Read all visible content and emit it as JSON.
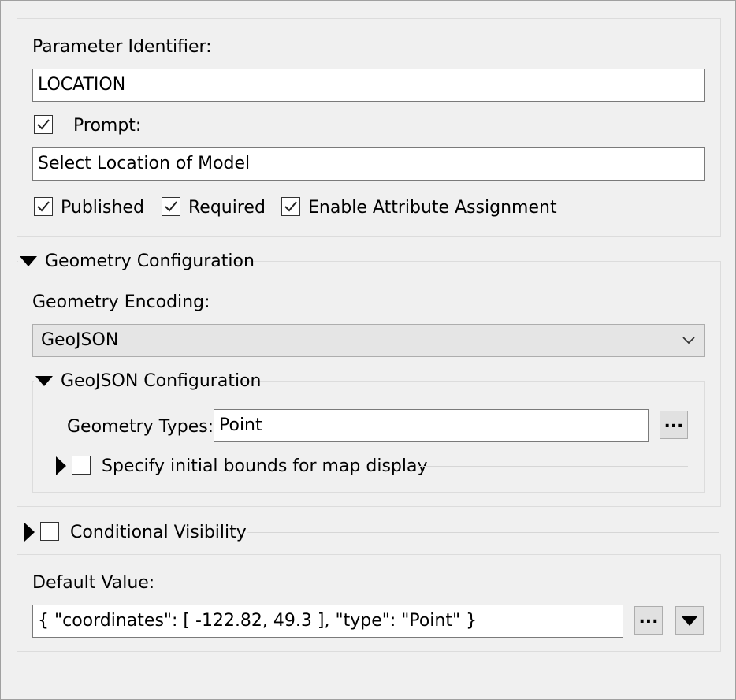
{
  "parameter": {
    "identifier_label": "Parameter Identifier:",
    "identifier_value": "LOCATION",
    "prompt_label": "Prompt:",
    "prompt_checked": true,
    "prompt_value": "Select Location of Model",
    "published_label": "Published",
    "required_label": "Required",
    "attr_assign_label": "Enable Attribute Assignment"
  },
  "geometry": {
    "section_title": "Geometry Configuration",
    "encoding_label": "Geometry Encoding:",
    "encoding_value": "GeoJSON",
    "geojson": {
      "section_title": "GeoJSON Configuration",
      "types_label": "Geometry Types:",
      "types_value": "Point",
      "types_button": "...",
      "bounds_label": "Specify initial bounds for map display"
    }
  },
  "visibility": {
    "section_title": "Conditional Visibility"
  },
  "default": {
    "label": "Default Value:",
    "value": "{ \"coordinates\": [ -122.82, 49.3 ], \"type\": \"Point\" }",
    "browse_button": "..."
  }
}
